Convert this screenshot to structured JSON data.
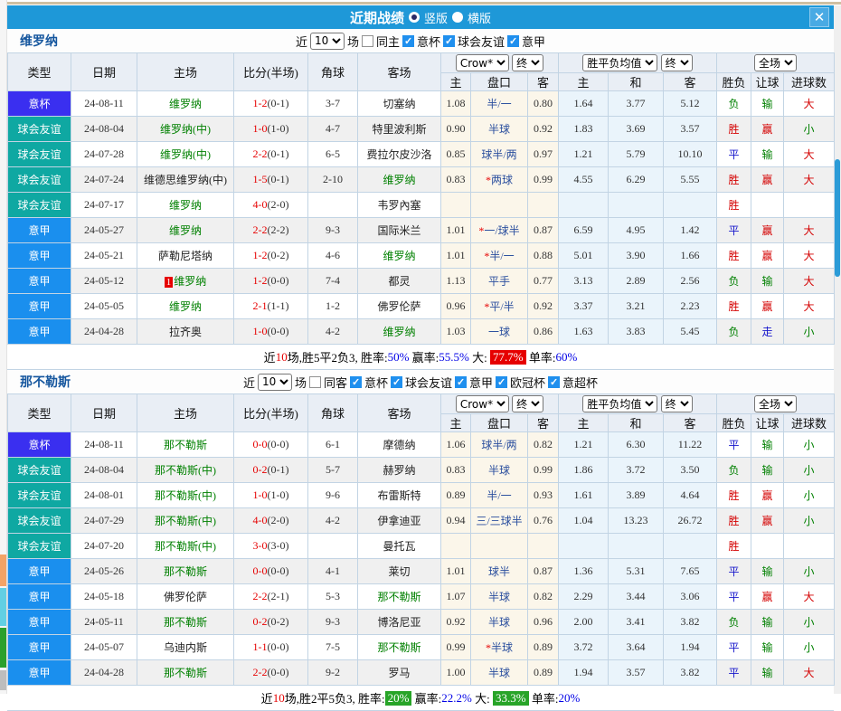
{
  "titlebar": {
    "title": "近期战绩",
    "radios": [
      {
        "label": "竖版",
        "selected": true
      },
      {
        "label": "横版",
        "selected": false
      }
    ],
    "close_icon": "✕"
  },
  "table_header": {
    "main_cols": [
      "类型",
      "日期",
      "主场",
      "比分(半场)",
      "角球",
      "客场"
    ],
    "odds_company_select": "Crow*",
    "odds_stage_select": "终",
    "avg_select": "胜平负均值",
    "avg_stage_select": "终",
    "scope_select": "全场",
    "sub_cols": [
      "主",
      "盘口",
      "客",
      "主",
      "和",
      "客",
      "胜负",
      "让球",
      "进球数"
    ]
  },
  "colors": {
    "titlebar_bg": "#1e98d8",
    "type_badges": {
      "意杯": "#3a2ff0",
      "球会友谊": "#0fa8a2",
      "意甲": "#1a8fee"
    },
    "result": {
      "胜": "#d40000",
      "平": "#1616cc",
      "负": "#008000"
    },
    "spread": {
      "赢": "#d40000",
      "走": "#1616cc",
      "输": "#008000"
    },
    "goals": {
      "大": "#d40000",
      "小": "#008000"
    },
    "team_green": "#008000",
    "score_full_red": "#e60000",
    "handicap_blue": "#2b4f9e",
    "avg_draw_blue": "#3a6ea5",
    "summary_blue": "#0000e6",
    "summary_red_bg": "#e60000",
    "summary_green_bg": "#28a428"
  },
  "sections": [
    {
      "team": "维罗纳",
      "filter": {
        "near_label": "近",
        "count": "10",
        "games_label": "场",
        "same_option": {
          "label": "同主",
          "checked": false
        },
        "league_options": [
          {
            "label": "意杯",
            "checked": true
          },
          {
            "label": "球会友谊",
            "checked": true
          },
          {
            "label": "意甲",
            "checked": true
          }
        ]
      },
      "rows": [
        {
          "type": "意杯",
          "date": "24-08-11",
          "home": "维罗纳",
          "home_green": true,
          "home_rank": "",
          "score_full": "1-2",
          "score_half": "(0-1)",
          "corners": "3-7",
          "away": "切塞纳",
          "away_green": false,
          "odds_home": "1.08",
          "handicap": "半/一",
          "handicap_star": false,
          "odds_away": "0.80",
          "avg_home": "1.64",
          "avg_draw": "3.77",
          "avg_away": "5.12",
          "result": "负",
          "spread_result": "输",
          "goals_result": "大"
        },
        {
          "type": "球会友谊",
          "date": "24-08-04",
          "home": "维罗纳(中)",
          "home_green": true,
          "home_rank": "",
          "score_full": "1-0",
          "score_half": "(1-0)",
          "corners": "4-7",
          "away": "特里波利斯",
          "away_green": false,
          "odds_home": "0.90",
          "handicap": "半球",
          "handicap_star": false,
          "odds_away": "0.92",
          "avg_home": "1.83",
          "avg_draw": "3.69",
          "avg_away": "3.57",
          "result": "胜",
          "spread_result": "赢",
          "goals_result": "小"
        },
        {
          "type": "球会友谊",
          "date": "24-07-28",
          "home": "维罗纳(中)",
          "home_green": true,
          "home_rank": "",
          "score_full": "2-2",
          "score_half": "(0-1)",
          "corners": "6-5",
          "away": "费拉尔皮沙洛",
          "away_green": false,
          "odds_home": "0.85",
          "handicap": "球半/两",
          "handicap_star": false,
          "odds_away": "0.97",
          "avg_home": "1.21",
          "avg_draw": "5.79",
          "avg_away": "10.10",
          "result": "平",
          "spread_result": "输",
          "goals_result": "大"
        },
        {
          "type": "球会友谊",
          "date": "24-07-24",
          "home": "维德思维罗纳(中)",
          "home_green": false,
          "home_rank": "",
          "score_full": "1-5",
          "score_half": "(0-1)",
          "corners": "2-10",
          "away": "维罗纳",
          "away_green": true,
          "odds_home": "0.83",
          "handicap": "两球",
          "handicap_star": true,
          "odds_away": "0.99",
          "avg_home": "4.55",
          "avg_draw": "6.29",
          "avg_away": "5.55",
          "result": "胜",
          "spread_result": "赢",
          "goals_result": "大"
        },
        {
          "type": "球会友谊",
          "date": "24-07-17",
          "home": "维罗纳",
          "home_green": true,
          "home_rank": "",
          "score_full": "4-0",
          "score_half": "(2-0)",
          "corners": "",
          "away": "韦罗內塞",
          "away_green": false,
          "odds_home": "",
          "handicap": "",
          "handicap_star": false,
          "odds_away": "",
          "avg_home": "",
          "avg_draw": "",
          "avg_away": "",
          "result": "胜",
          "spread_result": "",
          "goals_result": ""
        },
        {
          "type": "意甲",
          "date": "24-05-27",
          "home": "维罗纳",
          "home_green": true,
          "home_rank": "",
          "score_full": "2-2",
          "score_half": "(2-2)",
          "corners": "9-3",
          "away": "国际米兰",
          "away_green": false,
          "odds_home": "1.01",
          "handicap": "一/球半",
          "handicap_star": true,
          "odds_away": "0.87",
          "avg_home": "6.59",
          "avg_draw": "4.95",
          "avg_away": "1.42",
          "result": "平",
          "spread_result": "赢",
          "goals_result": "大"
        },
        {
          "type": "意甲",
          "date": "24-05-21",
          "home": "萨勒尼塔纳",
          "home_green": false,
          "home_rank": "",
          "score_full": "1-2",
          "score_half": "(0-2)",
          "corners": "4-6",
          "away": "维罗纳",
          "away_green": true,
          "odds_home": "1.01",
          "handicap": "半/一",
          "handicap_star": true,
          "odds_away": "0.88",
          "avg_home": "5.01",
          "avg_draw": "3.90",
          "avg_away": "1.66",
          "result": "胜",
          "spread_result": "赢",
          "goals_result": "大"
        },
        {
          "type": "意甲",
          "date": "24-05-12",
          "home": "维罗纳",
          "home_green": true,
          "home_rank": "1",
          "score_full": "1-2",
          "score_half": "(0-0)",
          "corners": "7-4",
          "away": "都灵",
          "away_green": false,
          "odds_home": "1.13",
          "handicap": "平手",
          "handicap_star": false,
          "odds_away": "0.77",
          "avg_home": "3.13",
          "avg_draw": "2.89",
          "avg_away": "2.56",
          "result": "负",
          "spread_result": "输",
          "goals_result": "大"
        },
        {
          "type": "意甲",
          "date": "24-05-05",
          "home": "维罗纳",
          "home_green": true,
          "home_rank": "",
          "score_full": "2-1",
          "score_half": "(1-1)",
          "corners": "1-2",
          "away": "佛罗伦萨",
          "away_green": false,
          "odds_home": "0.96",
          "handicap": "平/半",
          "handicap_star": true,
          "odds_away": "0.92",
          "avg_home": "3.37",
          "avg_draw": "3.21",
          "avg_away": "2.23",
          "result": "胜",
          "spread_result": "赢",
          "goals_result": "大"
        },
        {
          "type": "意甲",
          "date": "24-04-28",
          "home": "拉齐奥",
          "home_green": false,
          "home_rank": "",
          "score_full": "1-0",
          "score_half": "(0-0)",
          "corners": "4-2",
          "away": "维罗纳",
          "away_green": true,
          "odds_home": "1.03",
          "handicap": "一球",
          "handicap_star": false,
          "odds_away": "0.86",
          "avg_home": "1.63",
          "avg_draw": "3.83",
          "avg_away": "5.45",
          "result": "负",
          "spread_result": "走",
          "goals_result": "小"
        }
      ],
      "summary": [
        {
          "text": "近",
          "color": "#000"
        },
        {
          "text": "10",
          "color": "#e60000"
        },
        {
          "text": "场,胜5平2负3, 胜率:",
          "color": "#000"
        },
        {
          "text": "50%",
          "color": "#0000e6"
        },
        {
          "text": " 赢率:",
          "color": "#000"
        },
        {
          "text": "55.5%",
          "color": "#0000e6"
        },
        {
          "text": " 大: ",
          "color": "#000"
        },
        {
          "text": "77.7%",
          "color": "#fff",
          "bg": "#e60000"
        },
        {
          "text": " 单率:",
          "color": "#000"
        },
        {
          "text": "60%",
          "color": "#0000e6"
        }
      ]
    },
    {
      "team": "那不勒斯",
      "filter": {
        "near_label": "近",
        "count": "10",
        "games_label": "场",
        "same_option": {
          "label": "同客",
          "checked": false
        },
        "league_options": [
          {
            "label": "意杯",
            "checked": true
          },
          {
            "label": "球会友谊",
            "checked": true
          },
          {
            "label": "意甲",
            "checked": true
          },
          {
            "label": "欧冠杯",
            "checked": true
          },
          {
            "label": "意超杯",
            "checked": true
          }
        ]
      },
      "rows": [
        {
          "type": "意杯",
          "date": "24-08-11",
          "home": "那不勒斯",
          "home_green": true,
          "home_rank": "",
          "score_full": "0-0",
          "score_half": "(0-0)",
          "corners": "6-1",
          "away": "摩德纳",
          "away_green": false,
          "odds_home": "1.06",
          "handicap": "球半/两",
          "handicap_star": false,
          "odds_away": "0.82",
          "avg_home": "1.21",
          "avg_draw": "6.30",
          "avg_away": "11.22",
          "result": "平",
          "spread_result": "输",
          "goals_result": "小"
        },
        {
          "type": "球会友谊",
          "date": "24-08-04",
          "home": "那不勒斯(中)",
          "home_green": true,
          "home_rank": "",
          "score_full": "0-2",
          "score_half": "(0-1)",
          "corners": "5-7",
          "away": "赫罗纳",
          "away_green": false,
          "odds_home": "0.83",
          "handicap": "半球",
          "handicap_star": false,
          "odds_away": "0.99",
          "avg_home": "1.86",
          "avg_draw": "3.72",
          "avg_away": "3.50",
          "result": "负",
          "spread_result": "输",
          "goals_result": "小"
        },
        {
          "type": "球会友谊",
          "date": "24-08-01",
          "home": "那不勒斯(中)",
          "home_green": true,
          "home_rank": "",
          "score_full": "1-0",
          "score_half": "(1-0)",
          "corners": "9-6",
          "away": "布雷斯特",
          "away_green": false,
          "odds_home": "0.89",
          "handicap": "半/一",
          "handicap_star": false,
          "odds_away": "0.93",
          "avg_home": "1.61",
          "avg_draw": "3.89",
          "avg_away": "4.64",
          "result": "胜",
          "spread_result": "赢",
          "goals_result": "小"
        },
        {
          "type": "球会友谊",
          "date": "24-07-29",
          "home": "那不勒斯(中)",
          "home_green": true,
          "home_rank": "",
          "score_full": "4-0",
          "score_half": "(2-0)",
          "corners": "4-2",
          "away": "伊拿迪亚",
          "away_green": false,
          "odds_home": "0.94",
          "handicap": "三/三球半",
          "handicap_star": false,
          "odds_away": "0.76",
          "avg_home": "1.04",
          "avg_draw": "13.23",
          "avg_away": "26.72",
          "result": "胜",
          "spread_result": "赢",
          "goals_result": "小"
        },
        {
          "type": "球会友谊",
          "date": "24-07-20",
          "home": "那不勒斯(中)",
          "home_green": true,
          "home_rank": "",
          "score_full": "3-0",
          "score_half": "(3-0)",
          "corners": "",
          "away": "曼托瓦",
          "away_green": false,
          "odds_home": "",
          "handicap": "",
          "handicap_star": false,
          "odds_away": "",
          "avg_home": "",
          "avg_draw": "",
          "avg_away": "",
          "result": "胜",
          "spread_result": "",
          "goals_result": ""
        },
        {
          "type": "意甲",
          "date": "24-05-26",
          "home": "那不勒斯",
          "home_green": true,
          "home_rank": "",
          "score_full": "0-0",
          "score_half": "(0-0)",
          "corners": "4-1",
          "away": "莱切",
          "away_green": false,
          "odds_home": "1.01",
          "handicap": "球半",
          "handicap_star": false,
          "odds_away": "0.87",
          "avg_home": "1.36",
          "avg_draw": "5.31",
          "avg_away": "7.65",
          "result": "平",
          "spread_result": "输",
          "goals_result": "小"
        },
        {
          "type": "意甲",
          "date": "24-05-18",
          "home": "佛罗伦萨",
          "home_green": false,
          "home_rank": "",
          "score_full": "2-2",
          "score_half": "(2-1)",
          "corners": "5-3",
          "away": "那不勒斯",
          "away_green": true,
          "odds_home": "1.07",
          "handicap": "半球",
          "handicap_star": false,
          "odds_away": "0.82",
          "avg_home": "2.29",
          "avg_draw": "3.44",
          "avg_away": "3.06",
          "result": "平",
          "spread_result": "赢",
          "goals_result": "大"
        },
        {
          "type": "意甲",
          "date": "24-05-11",
          "home": "那不勒斯",
          "home_green": true,
          "home_rank": "",
          "score_full": "0-2",
          "score_half": "(0-2)",
          "corners": "9-3",
          "away": "博洛尼亚",
          "away_green": false,
          "odds_home": "0.92",
          "handicap": "半球",
          "handicap_star": false,
          "odds_away": "0.96",
          "avg_home": "2.00",
          "avg_draw": "3.41",
          "avg_away": "3.82",
          "result": "负",
          "spread_result": "输",
          "goals_result": "小"
        },
        {
          "type": "意甲",
          "date": "24-05-07",
          "home": "乌迪内斯",
          "home_green": false,
          "home_rank": "",
          "score_full": "1-1",
          "score_half": "(0-0)",
          "corners": "7-5",
          "away": "那不勒斯",
          "away_green": true,
          "odds_home": "0.99",
          "handicap": "半球",
          "handicap_star": true,
          "odds_away": "0.89",
          "avg_home": "3.72",
          "avg_draw": "3.64",
          "avg_away": "1.94",
          "result": "平",
          "spread_result": "输",
          "goals_result": "小"
        },
        {
          "type": "意甲",
          "date": "24-04-28",
          "home": "那不勒斯",
          "home_green": true,
          "home_rank": "",
          "score_full": "2-2",
          "score_half": "(0-0)",
          "corners": "9-2",
          "away": "罗马",
          "away_green": false,
          "odds_home": "1.00",
          "handicap": "半球",
          "handicap_star": false,
          "odds_away": "0.89",
          "avg_home": "1.94",
          "avg_draw": "3.57",
          "avg_away": "3.82",
          "result": "平",
          "spread_result": "输",
          "goals_result": "大"
        }
      ],
      "summary": [
        {
          "text": "近",
          "color": "#000"
        },
        {
          "text": "10",
          "color": "#e60000"
        },
        {
          "text": "场,胜2平5负3, 胜率:",
          "color": "#000"
        },
        {
          "text": "20%",
          "color": "#fff",
          "bg": "#28a428"
        },
        {
          "text": " 赢率:",
          "color": "#000"
        },
        {
          "text": "22.2%",
          "color": "#0000e6"
        },
        {
          "text": " 大: ",
          "color": "#000"
        },
        {
          "text": "33.3%",
          "color": "#fff",
          "bg": "#28a428"
        },
        {
          "text": " 单率:",
          "color": "#000"
        },
        {
          "text": "20%",
          "color": "#0000e6"
        }
      ]
    }
  ]
}
